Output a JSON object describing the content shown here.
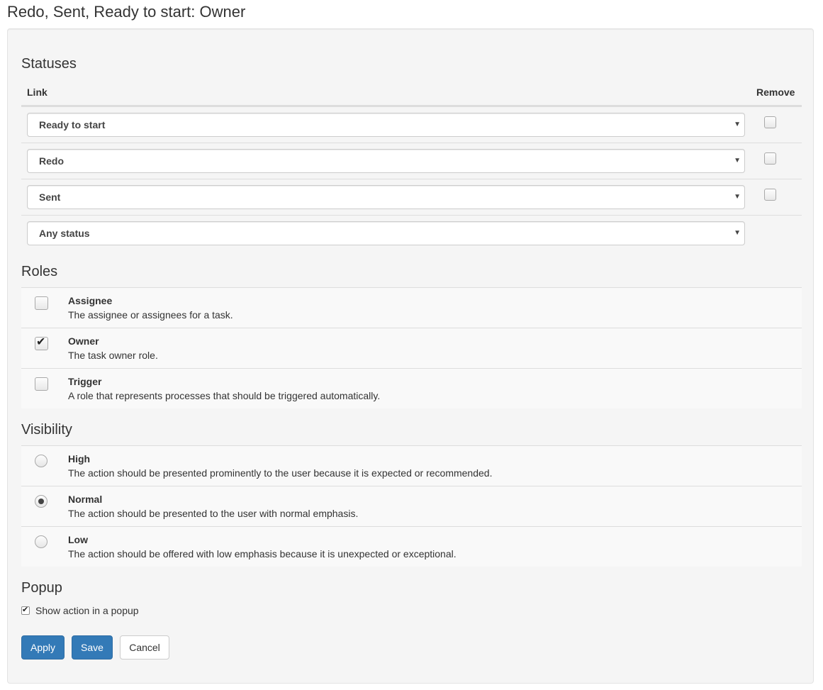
{
  "page": {
    "title": "Redo, Sent, Ready to start: Owner"
  },
  "statuses": {
    "heading": "Statuses",
    "col_link": "Link",
    "col_remove": "Remove",
    "rows": [
      {
        "value": "Ready to start",
        "removable": true,
        "remove_checked": false
      },
      {
        "value": "Redo",
        "removable": true,
        "remove_checked": false
      },
      {
        "value": "Sent",
        "removable": true,
        "remove_checked": false
      },
      {
        "value": "Any status",
        "removable": false
      }
    ],
    "caret": "▼"
  },
  "roles": {
    "heading": "Roles",
    "items": [
      {
        "name": "Assignee",
        "description": "The assignee or assignees for a task.",
        "checked": false
      },
      {
        "name": "Owner",
        "description": "The task owner role.",
        "checked": true
      },
      {
        "name": "Trigger",
        "description": "A role that represents processes that should be triggered automatically.",
        "checked": false
      }
    ],
    "check_mark": "✔"
  },
  "visibility": {
    "heading": "Visibility",
    "selected": "Normal",
    "items": [
      {
        "name": "High",
        "description": "The action should be presented prominently to the user because it is expected or recommended."
      },
      {
        "name": "Normal",
        "description": "The action should be presented to the user with normal emphasis."
      },
      {
        "name": "Low",
        "description": "The action should be offered with low emphasis because it is unexpected or exceptional."
      }
    ]
  },
  "popup": {
    "heading": "Popup",
    "label": "Show action in a popup",
    "checked": true,
    "check_mark": "✔"
  },
  "buttons": {
    "apply": "Apply",
    "save": "Save",
    "cancel": "Cancel"
  },
  "colors": {
    "primary": "#337ab7",
    "panel_bg": "#f5f5f5",
    "row_bg": "#f9f9f9"
  }
}
